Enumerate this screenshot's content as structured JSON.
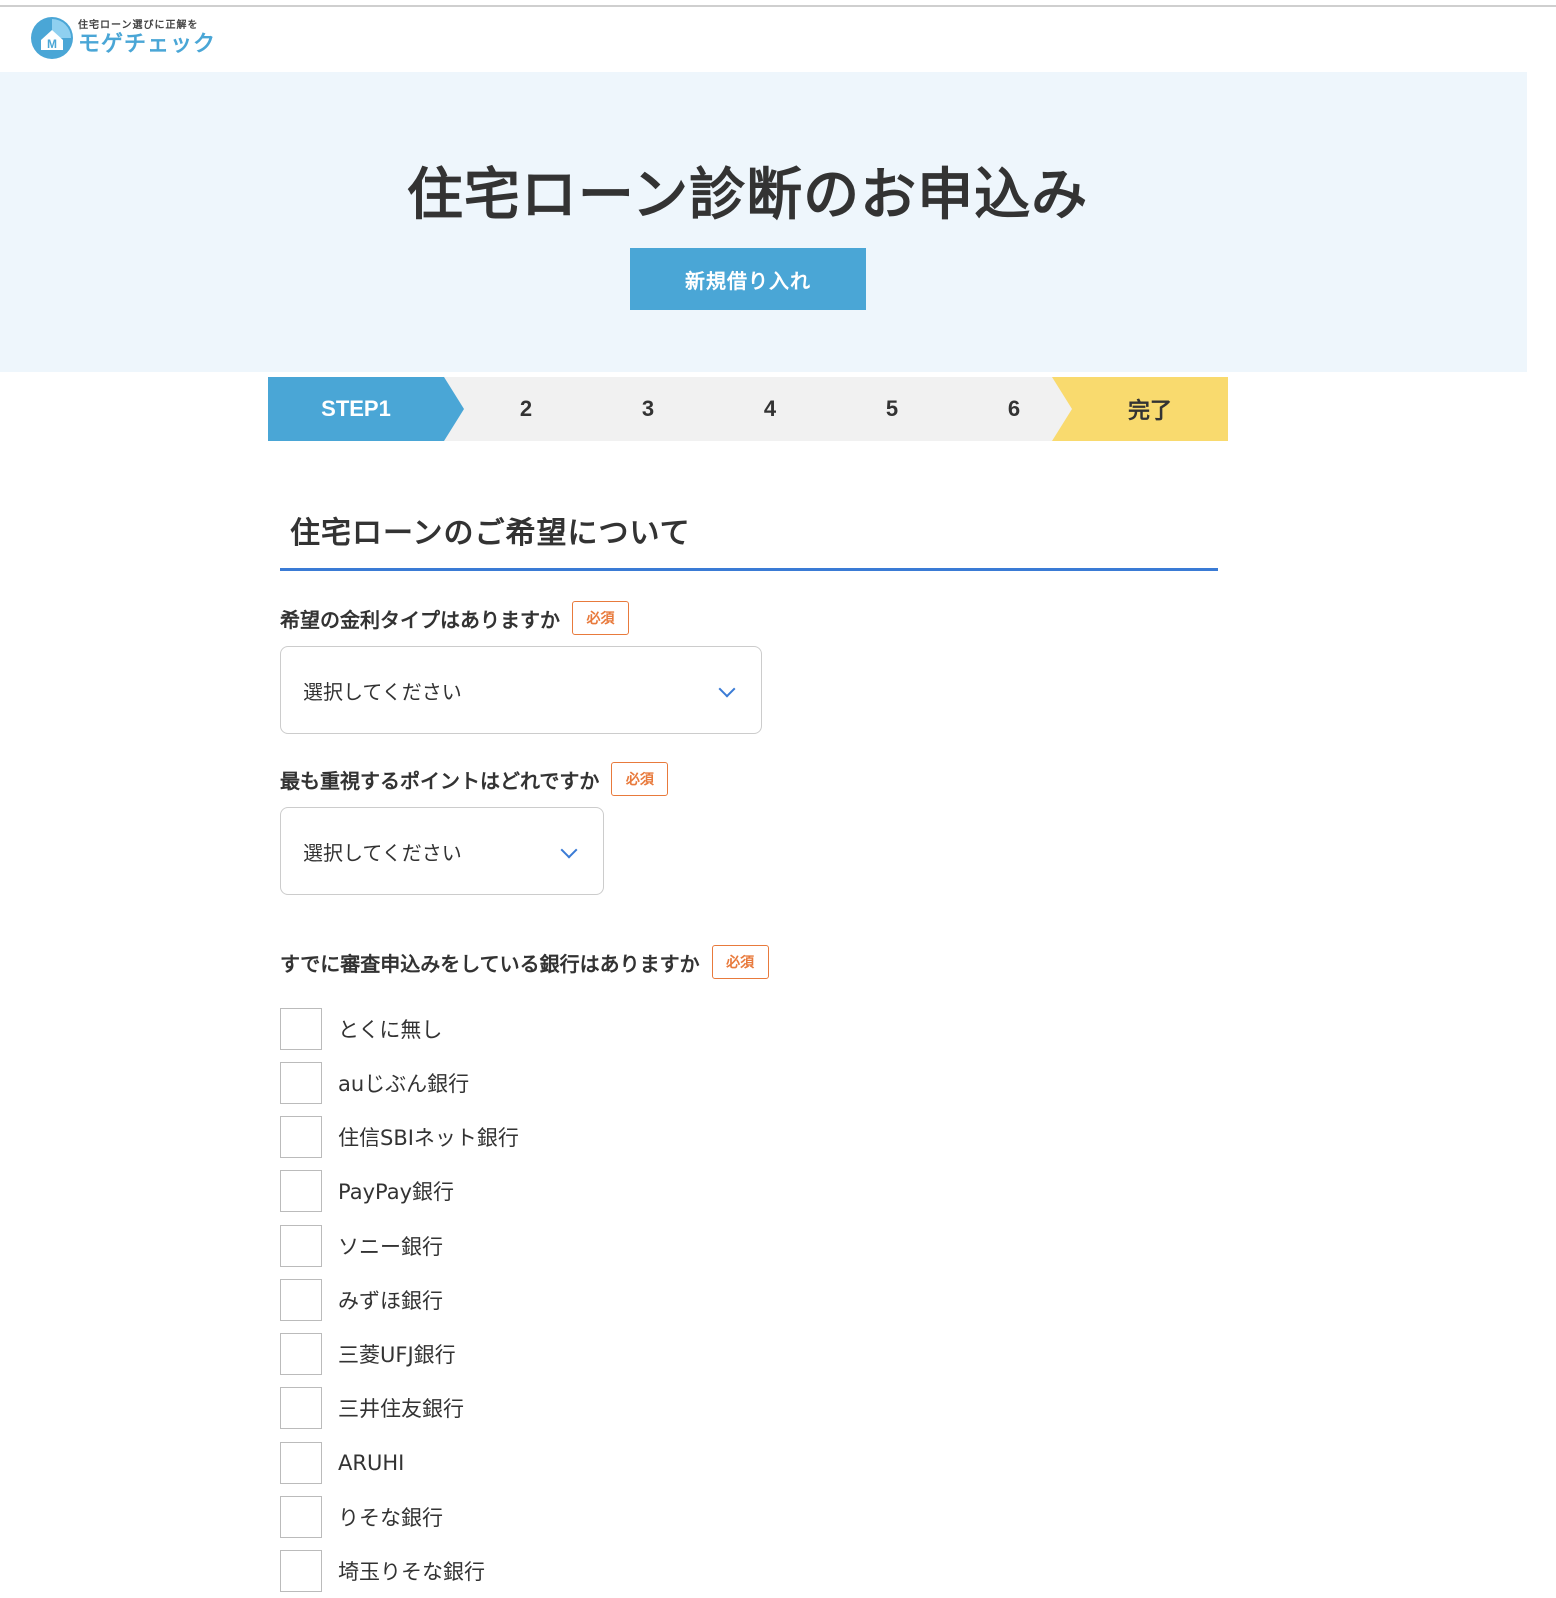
{
  "header": {
    "logo_tagline": "住宅ローン選びに正解を",
    "logo_name": "モゲチェック",
    "logo_mark_letter": "M"
  },
  "hero": {
    "title": "住宅ローン診断のお申込み",
    "tag": "新規借り入れ"
  },
  "steps": {
    "active": "STEP1",
    "numbers": [
      "2",
      "3",
      "4",
      "5",
      "6"
    ],
    "done": "完了"
  },
  "section": {
    "title": "住宅ローンのご希望について"
  },
  "required_label": "必須",
  "q1": {
    "label": "希望の金利タイプはありますか",
    "value": "選択してください"
  },
  "q2": {
    "label": "最も重視するポイントはどれですか",
    "value": "選択してください"
  },
  "q3": {
    "label": "すでに審査申込みをしている銀行はありますか",
    "options": [
      "とくに無し",
      "auじぶん銀行",
      "住信SBIネット銀行",
      "PayPay銀行",
      "ソニー銀行",
      "みずほ銀行",
      "三菱UFJ銀行",
      "三井住友銀行",
      "ARUHI",
      "りそな銀行",
      "埼玉りそな銀行"
    ]
  },
  "colors": {
    "brand_blue": "#4aa6d6",
    "accent_blue": "#3a7bd5",
    "required_orange": "#e87a3c",
    "done_yellow": "#f9da6e",
    "hero_bg": "#eef6fc"
  }
}
